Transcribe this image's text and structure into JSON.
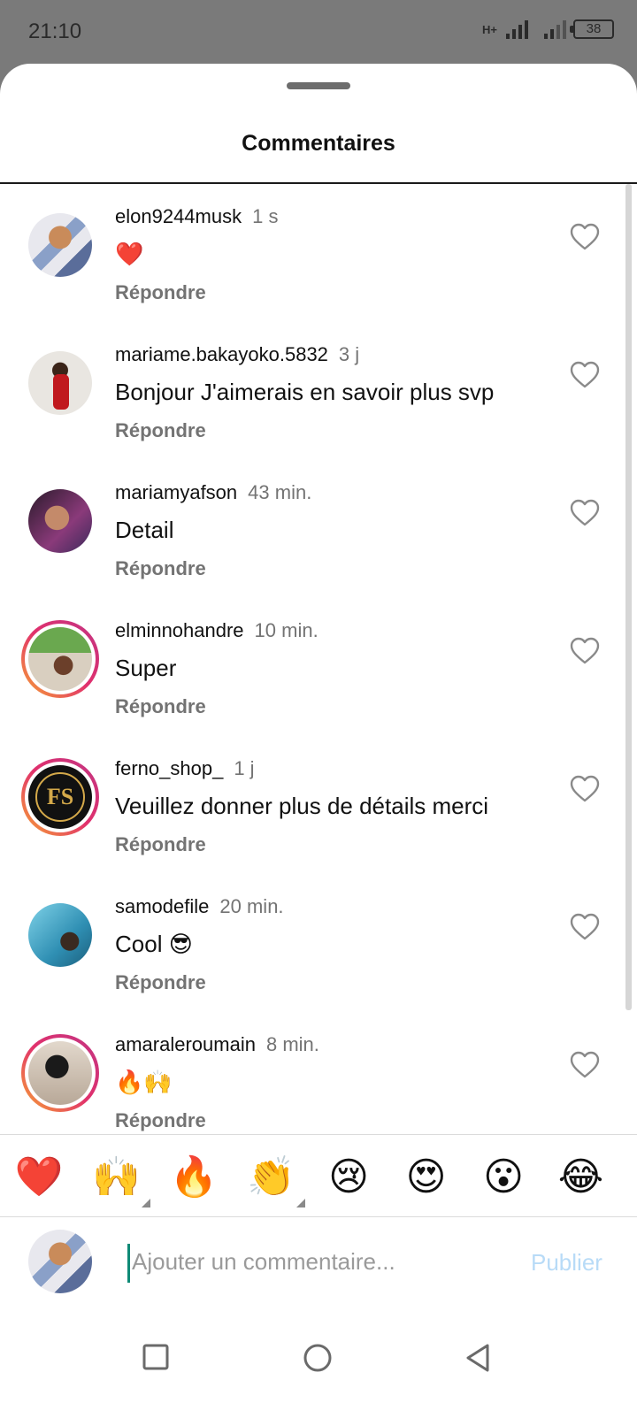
{
  "status_bar": {
    "time": "21:10",
    "network": "H+",
    "battery": "38"
  },
  "sheet": {
    "title": "Commentaires"
  },
  "reply_label": "Répondre",
  "comments": [
    {
      "username": "elon9244musk",
      "time": "1 s",
      "text": "❤️",
      "avatar": "a1",
      "ring": false
    },
    {
      "username": "mariame.bakayoko.5832",
      "time": "3 j",
      "text": "Bonjour J'aimerais en savoir plus svp",
      "avatar": "a2",
      "ring": false
    },
    {
      "username": "mariamyafson",
      "time": "43 min.",
      "text": "Detail",
      "avatar": "a3",
      "ring": false
    },
    {
      "username": "elminnohandre",
      "time": "10 min.",
      "text": "Super",
      "avatar": "a4",
      "ring": true
    },
    {
      "username": "ferno_shop_",
      "time": "1 j",
      "text": "Veuillez donner plus de détails merci",
      "avatar": "a5",
      "ring": true,
      "avatar_text": "FS"
    },
    {
      "username": "samodefile",
      "time": "20 min.",
      "text": "Cool 😎",
      "avatar": "a6",
      "ring": false
    },
    {
      "username": "amaraleroumain",
      "time": "8 min.",
      "text": "🔥🙌",
      "avatar": "a7",
      "ring": true
    }
  ],
  "emoji_reactions": [
    "❤️",
    "🙌",
    "🔥",
    "👏",
    "😢",
    "😍",
    "😮",
    "😂"
  ],
  "comment_input": {
    "placeholder": "Ajouter un commentaire...",
    "publish_label": "Publier"
  },
  "colors": {
    "accent": "#0095f6",
    "publish_disabled": "#b8dbf7",
    "secondary_text": "#737373",
    "ring_start": "#f7a534",
    "ring_end": "#c13584"
  }
}
